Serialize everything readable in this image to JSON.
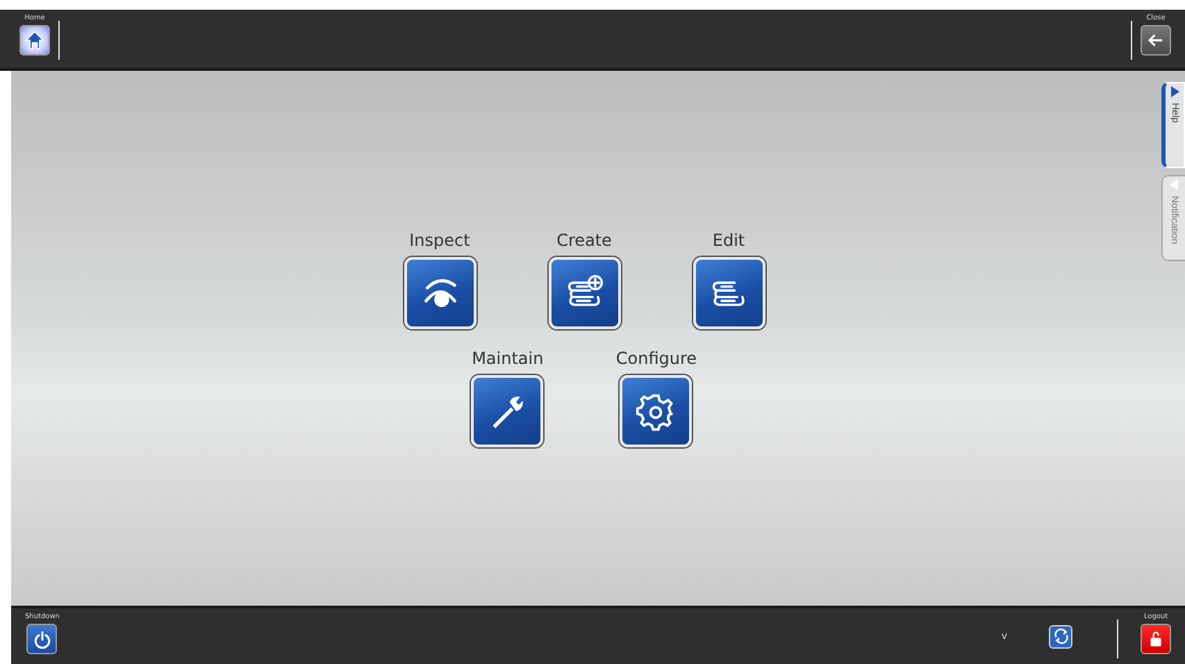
{
  "top_bar": {
    "home": {
      "label": "Home"
    },
    "close": {
      "label": "Close"
    }
  },
  "tile_rows": [
    [
      {
        "label": "Inspect",
        "kind": "eye"
      },
      {
        "label": "Create",
        "kind": "scroll-plus"
      },
      {
        "label": "Edit",
        "kind": "scroll"
      }
    ],
    [
      {
        "label": "Maintain",
        "kind": "wrench"
      },
      {
        "label": "Configure",
        "kind": "gear"
      }
    ]
  ],
  "side_tabs": [
    {
      "label": "Help",
      "selected": true
    },
    {
      "label": "Notification",
      "selected": false
    }
  ],
  "bottom_bar": {
    "shutdown": {
      "label": "Shutdown"
    },
    "indicator": "v",
    "logout": {
      "label": "Logout"
    }
  }
}
